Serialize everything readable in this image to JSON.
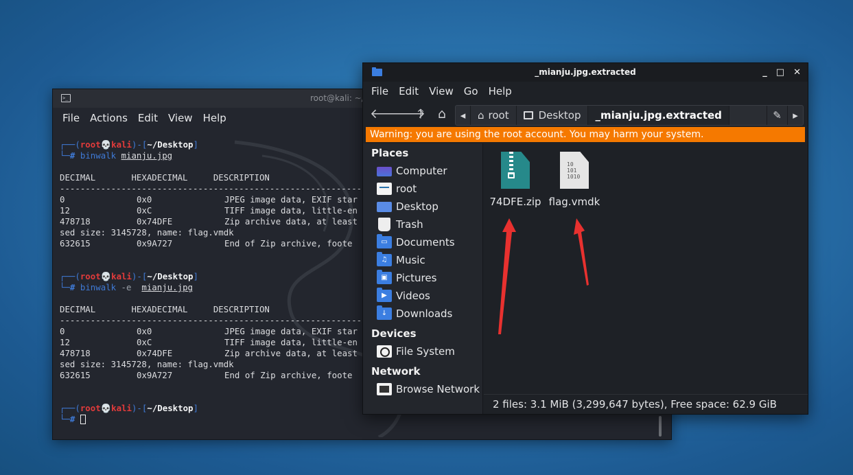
{
  "terminal": {
    "title": "root@kali: ~/D",
    "menu": [
      "File",
      "Actions",
      "Edit",
      "View",
      "Help"
    ],
    "prompt": {
      "user": "root",
      "skull": "💀",
      "host": "kali",
      "path": "~/Desktop"
    },
    "cmd1": {
      "tool": "binwalk",
      "arg": "mianju.jpg"
    },
    "cmd2": {
      "tool": "binwalk",
      "opt": "-e",
      "arg": "mianju.jpg"
    },
    "table_header": [
      "DECIMAL",
      "HEXADECIMAL",
      "DESCRIPTION"
    ],
    "divider": "--------------------------------------------------------------------------------",
    "rows": [
      {
        "dec": "0",
        "hex": "0x0",
        "desc": "JPEG image data, EXIF star"
      },
      {
        "dec": "12",
        "hex": "0xC",
        "desc": "TIFF image data, little-en"
      },
      {
        "dec": "478718",
        "hex": "0x74DFE",
        "desc": "Zip archive data, at least"
      },
      {
        "dec": "sed size: 3145728, name: flag.vmdk",
        "hex": "",
        "desc": ""
      },
      {
        "dec": "632615",
        "hex": "0x9A727",
        "desc": "End of Zip archive, foote"
      }
    ]
  },
  "filemanager": {
    "title": "_mianju.jpg.extracted",
    "window_buttons": [
      "_",
      "□",
      "✕"
    ],
    "menu": [
      "File",
      "Edit",
      "View",
      "Go",
      "Help"
    ],
    "path": [
      "root",
      "Desktop",
      "_mianju.jpg.extracted"
    ],
    "warning": "Warning: you are using the root account. You may harm your system.",
    "sidebar": {
      "places_header": "Places",
      "places": [
        "Computer",
        "root",
        "Desktop",
        "Trash",
        "Documents",
        "Music",
        "Pictures",
        "Videos",
        "Downloads"
      ],
      "devices_header": "Devices",
      "devices": [
        "File System"
      ],
      "network_header": "Network",
      "network": [
        "Browse Network"
      ]
    },
    "files": [
      {
        "name": "74DFE.zip",
        "type": "zip"
      },
      {
        "name": "flag.vmdk",
        "type": "vmdk",
        "icon_text": "10\n101\n1010"
      }
    ],
    "status": "2 files: 3.1 MiB (3,299,647 bytes), Free space: 62.9 GiB"
  },
  "colors": {
    "desktop": "#2a73ad",
    "warning": "#f57900",
    "annotation_arrow": "#e8312f",
    "folder": "#3b7ee1",
    "zip": "#26898a"
  }
}
